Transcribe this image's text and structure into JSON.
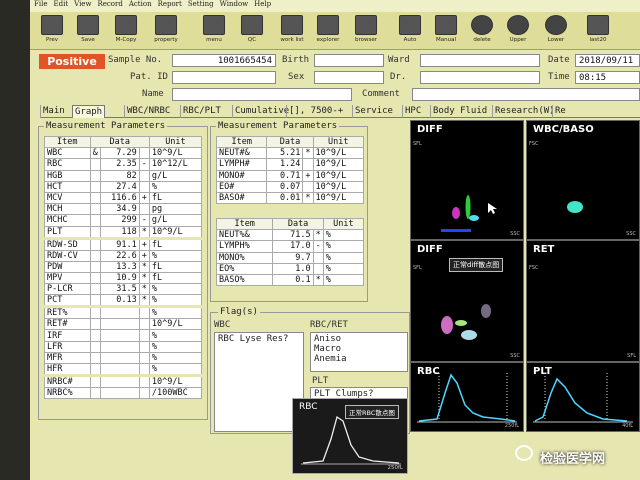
{
  "menu": [
    "File",
    "Edit",
    "View",
    "Record",
    "Action",
    "Report",
    "Setting",
    "Window",
    "Help"
  ],
  "toolbar": [
    {
      "label": "Prev",
      "icon": "prev-icon"
    },
    {
      "label": "Save",
      "icon": "save-icon"
    },
    {
      "label": "M-Copy",
      "icon": "copy-icon"
    },
    {
      "label": "property",
      "icon": "property-icon"
    },
    {
      "label": "menu",
      "icon": "menu-icon"
    },
    {
      "label": "QC",
      "icon": "qc-icon"
    },
    {
      "label": "work list",
      "icon": "worklist-icon"
    },
    {
      "label": "explorer",
      "icon": "explorer-icon"
    },
    {
      "label": "browser",
      "icon": "browser-icon"
    },
    {
      "label": "Auto",
      "icon": "auto-icon"
    },
    {
      "label": "Manual",
      "icon": "manual-icon"
    },
    {
      "label": "delete",
      "icon": "delete-icon"
    },
    {
      "label": "Upper",
      "icon": "upper-icon"
    },
    {
      "label": "Lower",
      "icon": "lower-icon"
    },
    {
      "label": "last20",
      "icon": "last20-icon"
    }
  ],
  "header": {
    "status": "Positive",
    "sample_no_label": "Sample No.",
    "sample_no": "1001665454",
    "birth_label": "Birth",
    "ward_label": "Ward",
    "date_label": "Date",
    "date": "2018/09/11",
    "pat_id_label": "Pat. ID",
    "sex_label": "Sex",
    "dr_label": "Dr.",
    "time_label": "Time",
    "time": "08:15",
    "name_label": "Name",
    "comment_label": "Comment"
  },
  "tabs": [
    "Main",
    "Graph",
    "WBC/NRBC",
    "RBC/PLT",
    "Cumulative",
    "[], 7500-+",
    "Service",
    "HPC",
    "Body Fluid",
    "Research(W)",
    "Re"
  ],
  "mp_left": {
    "title": "Measurement Parameters",
    "headers": [
      "Item",
      "Data",
      "Unit"
    ],
    "rows": [
      {
        "item": "WBC",
        "mark": "&",
        "data": "7.29",
        "flag": "",
        "unit": "10^9/L"
      },
      {
        "item": "RBC",
        "mark": "",
        "data": "2.35",
        "flag": "-",
        "unit": "10^12/L"
      },
      {
        "item": "HGB",
        "mark": "",
        "data": "82",
        "flag": "",
        "unit": "g/L"
      },
      {
        "item": "HCT",
        "mark": "",
        "data": "27.4",
        "flag": "",
        "unit": "%"
      },
      {
        "item": "MCV",
        "mark": "",
        "data": "116.6",
        "flag": "+",
        "unit": "fL"
      },
      {
        "item": "MCH",
        "mark": "",
        "data": "34.9",
        "flag": "",
        "unit": "pg"
      },
      {
        "item": "MCHC",
        "mark": "",
        "data": "299",
        "flag": "-",
        "unit": "g/L"
      },
      {
        "item": "PLT",
        "mark": "",
        "data": "118",
        "flag": "*",
        "unit": "10^9/L"
      },
      {
        "item": "RDW-SD",
        "mark": "",
        "data": "91.1",
        "flag": "+",
        "unit": "fL"
      },
      {
        "item": "RDW-CV",
        "mark": "",
        "data": "22.6",
        "flag": "+",
        "unit": "%"
      },
      {
        "item": "PDW",
        "mark": "",
        "data": "13.3",
        "flag": "*",
        "unit": "fL"
      },
      {
        "item": "MPV",
        "mark": "",
        "data": "10.9",
        "flag": "*",
        "unit": "fL"
      },
      {
        "item": "P-LCR",
        "mark": "",
        "data": "31.5",
        "flag": "*",
        "unit": "%"
      },
      {
        "item": "PCT",
        "mark": "",
        "data": "0.13",
        "flag": "*",
        "unit": "%"
      },
      {
        "item": "RET%",
        "mark": "",
        "data": "",
        "flag": "",
        "unit": "%"
      },
      {
        "item": "RET#",
        "mark": "",
        "data": "",
        "flag": "",
        "unit": "10^9/L"
      },
      {
        "item": "IRF",
        "mark": "",
        "data": "",
        "flag": "",
        "unit": "%"
      },
      {
        "item": "LFR",
        "mark": "",
        "data": "",
        "flag": "",
        "unit": "%"
      },
      {
        "item": "MFR",
        "mark": "",
        "data": "",
        "flag": "",
        "unit": "%"
      },
      {
        "item": "HFR",
        "mark": "",
        "data": "",
        "flag": "",
        "unit": "%"
      },
      {
        "item": "NRBC#",
        "mark": "",
        "data": "",
        "flag": "",
        "unit": "10^9/L"
      },
      {
        "item": "NRBC%",
        "mark": "",
        "data": "",
        "flag": "",
        "unit": "/100WBC"
      }
    ]
  },
  "mp_right": {
    "title": "Measurement Parameters",
    "headers": [
      "Item",
      "Data",
      "Unit"
    ],
    "abs_rows": [
      {
        "item": "NEUT#&",
        "data": "5.21",
        "flag": "*",
        "unit": "10^9/L"
      },
      {
        "item": "LYMPH#",
        "data": "1.24",
        "flag": "",
        "unit": "10^9/L"
      },
      {
        "item": "MONO#",
        "data": "0.71",
        "flag": "+",
        "unit": "10^9/L"
      },
      {
        "item": "EO#",
        "data": "0.07",
        "flag": "",
        "unit": "10^9/L"
      },
      {
        "item": "BASO#",
        "data": "0.01",
        "flag": "*",
        "unit": "10^9/L"
      }
    ],
    "pct_rows": [
      {
        "item": "NEUT%&",
        "data": "71.5",
        "flag": "*",
        "unit": "%"
      },
      {
        "item": "LYMPH%",
        "data": "17.0",
        "flag": "-",
        "unit": "%"
      },
      {
        "item": "MONO%",
        "data": "9.7",
        "flag": "",
        "unit": "%"
      },
      {
        "item": "EO%",
        "data": "1.0",
        "flag": "",
        "unit": "%"
      },
      {
        "item": "BASO%",
        "data": "0.1",
        "flag": "*",
        "unit": "%"
      }
    ]
  },
  "flags": {
    "title": "Flag(s)",
    "wbc_label": "WBC",
    "wbc_box": "RBC Lyse Res?",
    "rbcret_label": "RBC/RET",
    "rbcret_items": [
      "Aniso",
      "Macro",
      "Anemia"
    ],
    "plt_label": "PLT",
    "plt_box": "PLT Clumps?"
  },
  "graphs": {
    "diff": "DIFF",
    "wbcbaso": "WBC/BASO",
    "diff2": "DIFF",
    "ret": "RET",
    "rbc": "RBC",
    "plt": "PLT",
    "ssc": "SSC",
    "sfl": "SFL",
    "fsc": "FSC",
    "fl250": "250fL",
    "fl40": "40fL",
    "diff_caption": "正常diff散点图",
    "rbc_overlay_title": "RBC",
    "rbc_overlay_caption": "正常RBC散点图",
    "rbc_overlay_axis": "250fL"
  },
  "watermark": "检验医学网"
}
